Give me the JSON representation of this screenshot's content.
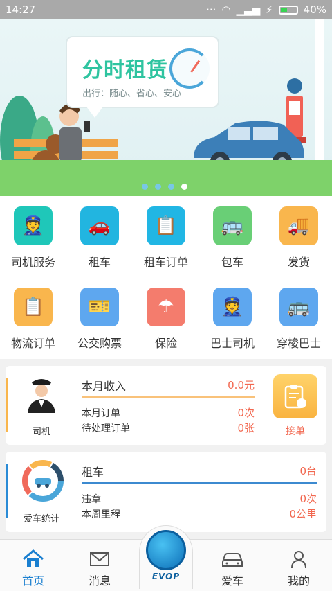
{
  "status_bar": {
    "time": "14:27",
    "battery": "40%"
  },
  "banner": {
    "title": "分时租赁",
    "subtitle": "出行：随心、省心、安心",
    "dots": 4,
    "active_dot": 4
  },
  "services_row1": [
    {
      "label": "司机服务",
      "icon": "driver-icon",
      "color": "#1fc7b9"
    },
    {
      "label": "租车",
      "icon": "car-icon",
      "color": "#22b5e0"
    },
    {
      "label": "租车订单",
      "icon": "order-icon",
      "color": "#21b6e4"
    },
    {
      "label": "包车",
      "icon": "bus-icon",
      "color": "#69cf76"
    },
    {
      "label": "发货",
      "icon": "truck-icon",
      "color": "#f9b64d"
    }
  ],
  "services_row2": [
    {
      "label": "物流订单",
      "icon": "logistics-order-icon",
      "color": "#f9b64d"
    },
    {
      "label": "公交购票",
      "icon": "ticket-icon",
      "color": "#5ea7ef"
    },
    {
      "label": "保险",
      "icon": "umbrella-icon",
      "color": "#f47c6d"
    },
    {
      "label": "巴士司机",
      "icon": "bus-driver-icon",
      "color": "#5ea7ef"
    },
    {
      "label": "穿梭巴士",
      "icon": "shuttle-bus-icon",
      "color": "#5ea7ef"
    }
  ],
  "driver_card": {
    "avatar_label": "司机",
    "title": "本月收入",
    "title_value": "0.0元",
    "rows": [
      {
        "label": "本月订单",
        "value": "0次"
      },
      {
        "label": "待处理订单",
        "value": "0张"
      }
    ],
    "accept_label": "接单"
  },
  "car_card": {
    "avatar_label": "爱车统计",
    "title": "租车",
    "title_value": "0台",
    "rows": [
      {
        "label": "违章",
        "value": "0次"
      },
      {
        "label": "本周里程",
        "value": "0公里"
      }
    ]
  },
  "nav": {
    "home": "首页",
    "messages": "消息",
    "center_logo": "EVOP",
    "car": "爱车",
    "mine": "我的"
  },
  "colors": {
    "accent_blue": "#1a7fd0",
    "value_red": "#f2674f",
    "income_bar": "#f9c27a",
    "car_bar": "#3c8ad0"
  }
}
